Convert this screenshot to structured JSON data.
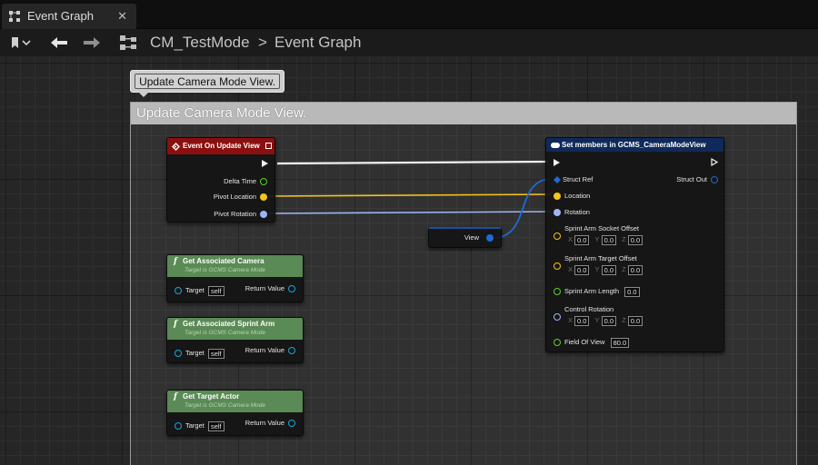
{
  "tab": {
    "icon": "blueprint-graph-icon",
    "label": "Event Graph",
    "close": "✕"
  },
  "toolbar": {
    "bookmark_icon": "bookmark-icon",
    "back_icon": "arrow-left-icon",
    "forward_icon": "arrow-right-icon",
    "breadcrumb": [
      "CM_TestMode",
      "Event Graph"
    ],
    "separator": ">"
  },
  "comment": {
    "bubble_text": "Update Camera Mode View.",
    "header": "Update Camera Mode View."
  },
  "nodes": {
    "event": {
      "title": "Event On Update View",
      "color": "#8c0f0f",
      "pins": [
        "Delta Time",
        "Pivot Location",
        "Pivot Rotation"
      ]
    },
    "set_members": {
      "title": "Set members in GCMS_CameraModeView",
      "color": "#0f2a5a",
      "struct_ref": "Struct Ref",
      "struct_out": "Struct Out",
      "location": "Location",
      "rotation": "Rotation",
      "socket_offset": {
        "label": "Sprint Arm Socket Offset",
        "x": "0.0",
        "y": "0.0",
        "z": "0.0"
      },
      "target_offset": {
        "label": "Sprint Arm Target Offset",
        "x": "0.0",
        "y": "0.0",
        "z": "0.0"
      },
      "arm_length": {
        "label": "Sprint Arm Length",
        "value": "0.0"
      },
      "control_rotation": {
        "label": "Control Rotation",
        "x": "0.0",
        "y": "0.0",
        "z": "0.0"
      },
      "fov": {
        "label": "Field Of View",
        "value": "80.0"
      },
      "axes": {
        "x": "X",
        "y": "Y",
        "z": "Z"
      }
    },
    "view": {
      "label": "View"
    },
    "get_camera": {
      "title": "Get Associated Camera",
      "subtitle": "Target is GCMS Camera Mode",
      "target": "Target",
      "self": "self",
      "return": "Return Value"
    },
    "get_sprint_arm": {
      "title": "Get Associated Sprint Arm",
      "subtitle": "Target is GCMS Camera Mode",
      "target": "Target",
      "self": "self",
      "return": "Return Value"
    },
    "get_target_actor": {
      "title": "Get Target Actor",
      "subtitle": "Target is GCMS Camera Mode",
      "target": "Target",
      "self": "self",
      "return": "Return Value"
    },
    "function_glyph": "f"
  },
  "colors": {
    "exec": "#f2f2f2",
    "float": "#55d12d",
    "vector": "#f5c518",
    "rotator": "#9fb4f5",
    "struct": "#1c6bd8",
    "object": "#1aa6d8",
    "function_header": "#5a8a55"
  }
}
